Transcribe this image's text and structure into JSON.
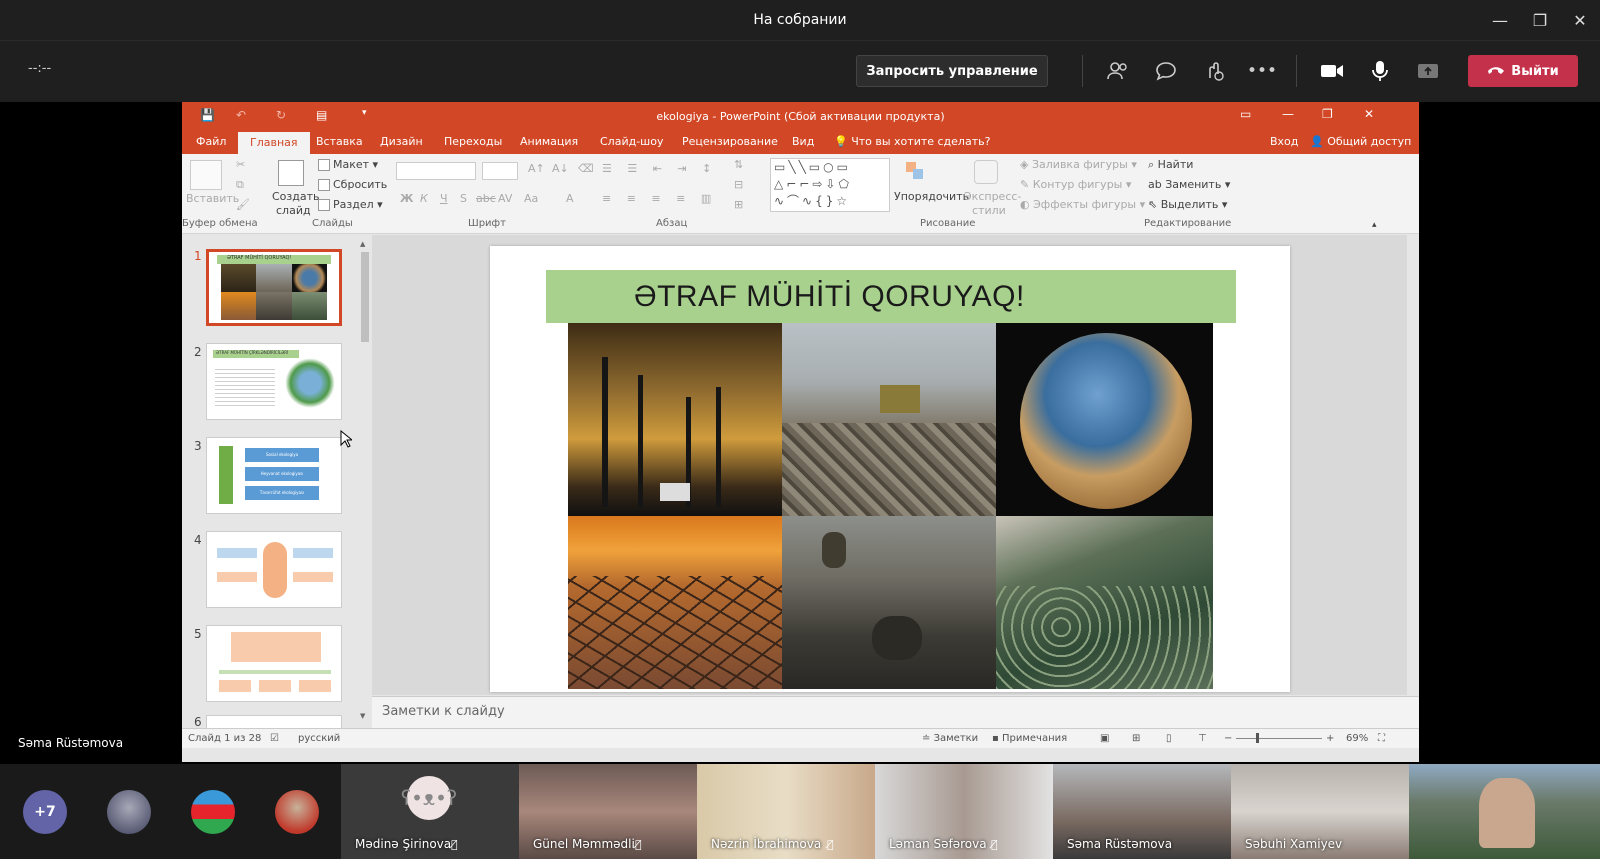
{
  "teams": {
    "window_title": "На собрании",
    "timer": "--:--",
    "request_control": "Запросить управление",
    "leave": "Выйти",
    "presenter_name": "Səma Rüstəmova",
    "overflow_count": "+7"
  },
  "ppt": {
    "title": "ekologiya - PowerPoint (Сбой активации продукта)",
    "tabs": [
      "Файл",
      "Главная",
      "Вставка",
      "Дизайн",
      "Переходы",
      "Анимация",
      "Слайд-шоу",
      "Рецензирование",
      "Вид"
    ],
    "tell_me": "Что вы хотите сделать?",
    "sign_in": "Вход",
    "share": "Общий доступ",
    "ribbon": {
      "paste": "Вставить",
      "new_slide_1": "Создать",
      "new_slide_2": "слайд",
      "layout": "Макет",
      "reset": "Сбросить",
      "section": "Раздел",
      "arrange": "Упорядочить",
      "quick_styles_1": "Экспресс-",
      "quick_styles_2": "стили",
      "shape_fill": "Заливка фигуры",
      "shape_outline": "Контур фигуры",
      "shape_effects": "Эффекты фигуры",
      "find": "Найти",
      "replace": "Заменить",
      "select": "Выделить",
      "bold": "Ж",
      "italic": "К",
      "underline": "Ч",
      "shadow": "S",
      "strike": "abc",
      "spacing": "AV",
      "case": "Aa",
      "color": "A"
    },
    "groups": [
      "Буфер обмена",
      "Слайды",
      "Шрифт",
      "Абзац",
      "Рисование",
      "Редактирование"
    ],
    "thumbnails": [
      "1",
      "2",
      "3",
      "4",
      "5",
      "6"
    ],
    "thumb1_title": "ƏTRAF MÜHİTİ QORUYAQ!",
    "thumb2_title": "ƏTRAF MÜHİTİN ÇİRKLƏNDİRİCİLƏRİ",
    "thumb3_items": [
      "Sosial ekologiya",
      "Heyvanat ekologiyası",
      "Təsərrüfat ekologiyası"
    ],
    "slide_title": "ƏTRAF MÜHİTİ QORUYAQ!",
    "notes_placeholder": "Заметки к слайду",
    "status": {
      "slide": "Слайд 1 из 28",
      "language": "русский",
      "notes": "Заметки",
      "comments": "Примечания",
      "zoom": "69%"
    }
  },
  "participants": [
    {
      "name": "Mədinə Şirinova",
      "muted": true
    },
    {
      "name": "Günel Məmmədli",
      "muted": true
    },
    {
      "name": "Nəzrin İbrahimova",
      "muted": true
    },
    {
      "name": "Ləman Səfərova",
      "muted": true
    },
    {
      "name": "Səma Rüstəmova",
      "muted": false
    },
    {
      "name": "Səbuhi Xamiyev",
      "muted": false
    }
  ],
  "colors": {
    "accent": "#d24726",
    "leave": "#c4314b",
    "slide_header": "#a9d18e",
    "avatar_overflow": "#6264a7"
  }
}
